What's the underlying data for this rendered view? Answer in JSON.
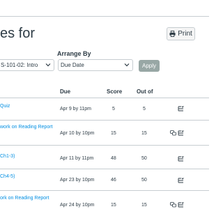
{
  "header": {
    "title": "es for",
    "print_label": "Print"
  },
  "filters": {
    "course_value": "S-101-02: Intro",
    "arrange_label": "Arrange By",
    "arrange_value": "Due Date",
    "apply_label": "Apply"
  },
  "table": {
    "columns": {
      "due": "Due",
      "score": "Score",
      "out_of": "Out of"
    },
    "rows": [
      {
        "name": "Quiz",
        "due": "Apr 9 by 11pm",
        "score": "5",
        "out_of": "5"
      },
      {
        "name": "work on Reading Report",
        "due": "Apr 10 by 10pm",
        "score": "15",
        "out_of": "15"
      },
      {
        "name": "Ch1-3)",
        "due": "Apr 11 by 11pm",
        "score": "48",
        "out_of": "50"
      },
      {
        "name": "Ch4-5)",
        "due": "Apr 23 by 10pm",
        "score": "46",
        "out_of": "50"
      },
      {
        "name": "ork on Reading Report",
        "due": "Apr 24 by 10pm",
        "score": "15",
        "out_of": "15"
      }
    ]
  },
  "colors": {
    "link": "#008ee2",
    "apply_button": "#98a7a5",
    "text": "#2d3b45"
  }
}
